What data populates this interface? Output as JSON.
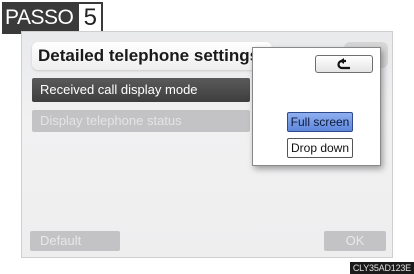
{
  "step": {
    "word": "PASSO",
    "number": "5"
  },
  "screen": {
    "title": "Detailed telephone settings",
    "rows": {
      "received_call_display_mode": "Received call display mode",
      "display_telephone_status": "Display telephone status"
    },
    "buttons": {
      "default": "Default",
      "ok": "OK"
    }
  },
  "popup": {
    "back_icon": "back-arrow-icon",
    "options": {
      "full_screen": "Full screen",
      "drop_down": "Drop down"
    },
    "selected": "Full screen"
  },
  "image_code": "CLY35AD123E",
  "colors": {
    "selected_option": "#6f94e4",
    "active_row": "#4a4a4a",
    "disabled": "#c3c3c5"
  }
}
